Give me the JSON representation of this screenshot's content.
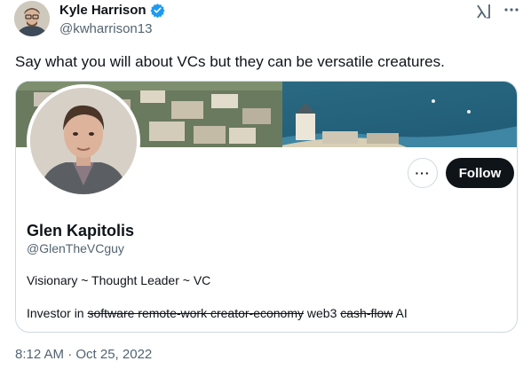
{
  "author": {
    "name": "Kyle Harrison",
    "handle": "@kwharrison13",
    "verified": true,
    "verified_color": "#1d9bf0"
  },
  "header_icons": [
    "grok-icon",
    "more-icon"
  ],
  "tweet": {
    "text": "Say what you will about VCs but they can be versatile creatures.",
    "timestamp": "8:12 AM · Oct 25, 2022"
  },
  "card": {
    "profile_name": "Glen Kapitolis",
    "profile_handle": "@GlenTheVCguy",
    "more_label": "···",
    "follow_label": "Follow",
    "bio_line1": "Visionary ~ Thought Leader ~ VC",
    "bio_line2": {
      "prefix": "Investor in",
      "struck_1": "software remote-work creator-economy",
      "plain": "web3",
      "struck_2": "cash-flow",
      "suffix": "AI"
    }
  },
  "colors": {
    "text_primary": "#0f1419",
    "text_secondary": "#536471",
    "border": "#cfd9de",
    "follow_bg": "#0f1419"
  }
}
